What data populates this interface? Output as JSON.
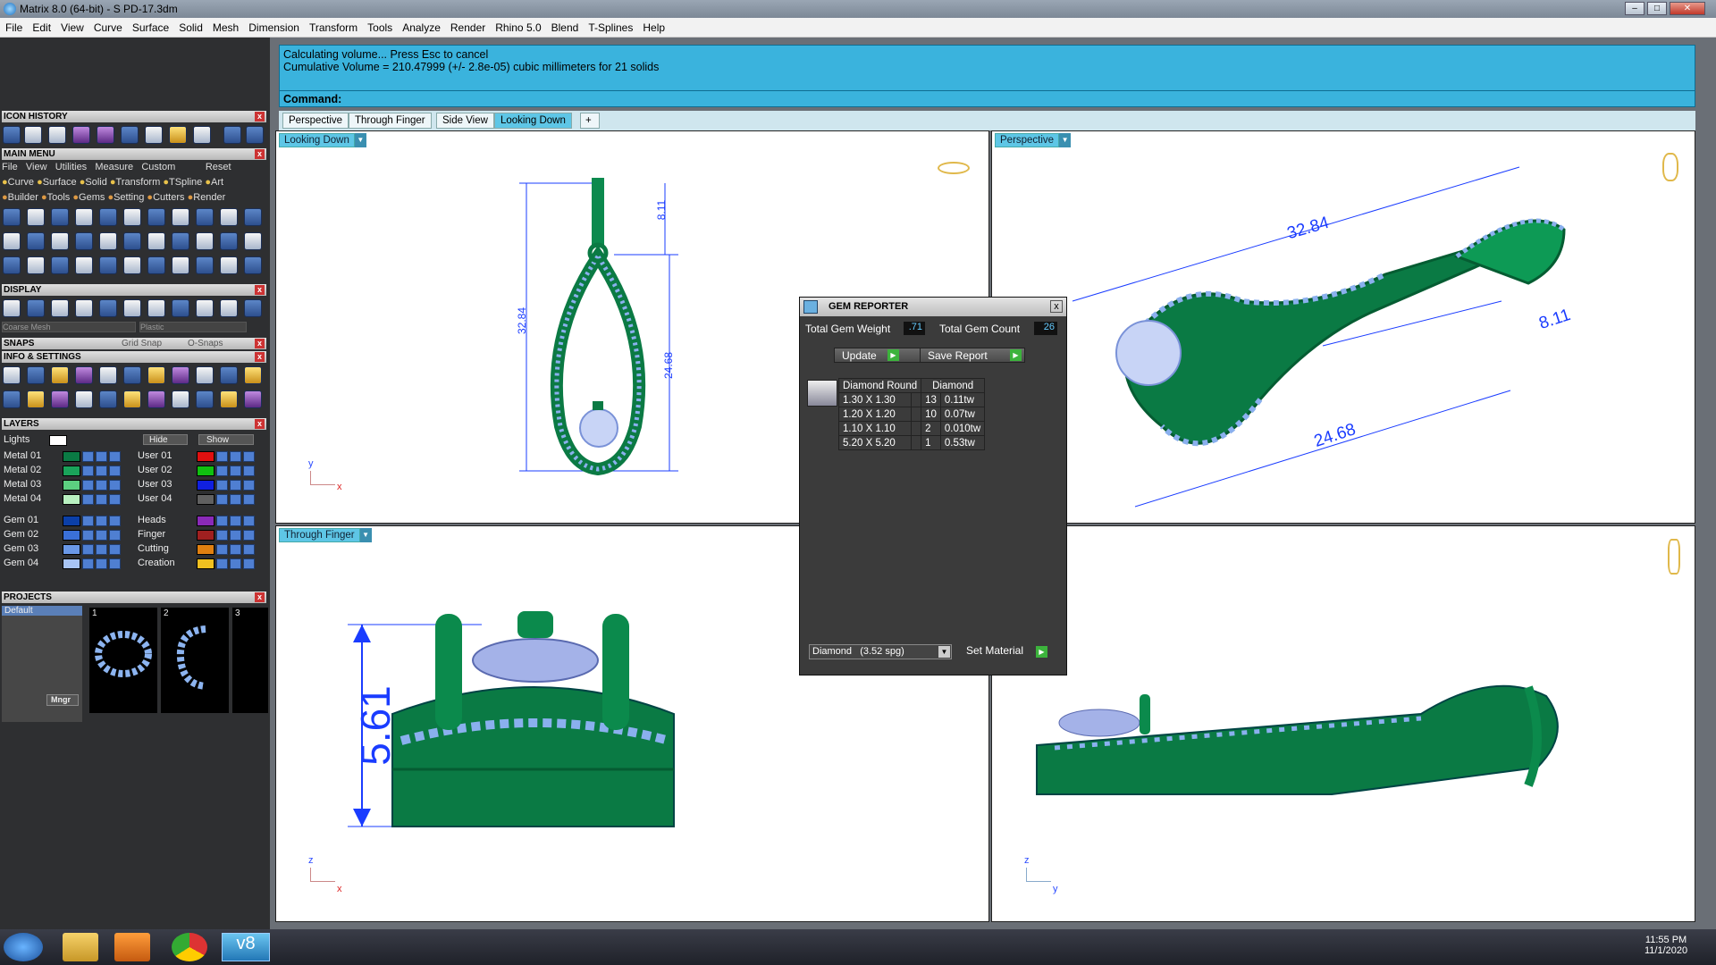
{
  "title": "Matrix 8.0 (64-bit) - S PD-17.3dm",
  "menu": [
    "File",
    "Edit",
    "View",
    "Curve",
    "Surface",
    "Solid",
    "Mesh",
    "Dimension",
    "Transform",
    "Tools",
    "Analyze",
    "Render",
    "Rhino 5.0",
    "Blend",
    "T-Splines",
    "Help"
  ],
  "cmd": {
    "line1": "Calculating volume... Press Esc to cancel",
    "line2": "Cumulative Volume = 210.47999 (+/- 2.8e-05) cubic millimeters for 21 solids",
    "prompt": "Command:"
  },
  "tabs": [
    "Perspective",
    "Through Finger",
    "Side View",
    "Looking Down"
  ],
  "panels": {
    "icon_history": "ICON HISTORY",
    "main_menu": "MAIN MENU",
    "main_menu_items": [
      "File",
      "View",
      "Utilities",
      "Measure",
      "Custom",
      "Reset"
    ],
    "main_menu_row1": [
      "Curve",
      "Surface",
      "Solid",
      "Transform",
      "TSpline",
      "Art"
    ],
    "main_menu_row2": [
      "Builder",
      "Tools",
      "Gems",
      "Setting",
      "Cutters",
      "Render"
    ],
    "display": "DISPLAY",
    "display_mesh": "Coarse Mesh",
    "display_material": "Plastic",
    "snaps": "SNAPS",
    "grid_snap": "Grid Snap",
    "osnaps": "O-Snaps",
    "info": "INFO & SETTINGS",
    "layers": "LAYERS",
    "lights": "Lights",
    "hide": "Hide",
    "show": "Show",
    "layers_left": [
      "Metal 01",
      "Metal 02",
      "Metal 03",
      "Metal 04",
      "Gem 01",
      "Gem 02",
      "Gem 03",
      "Gem 04"
    ],
    "layers_right": [
      "User 01",
      "User 02",
      "User 03",
      "User 04",
      "Heads",
      "Finger",
      "Cutting",
      "Creation"
    ],
    "projects": "PROJECTS",
    "project_default": "Default",
    "project_nums": [
      "1",
      "2",
      "3"
    ],
    "mngr": "Mngr"
  },
  "viewports": {
    "tl": {
      "label": "Looking Down",
      "dims": [
        "8.11",
        "32.84",
        "24.68"
      ],
      "axis": [
        "y",
        "x"
      ]
    },
    "tr": {
      "label": "Perspective",
      "dims": [
        "32.84",
        "8.11",
        "24.68"
      ]
    },
    "bl": {
      "label": "Through Finger",
      "dims": [
        "5.61"
      ],
      "axis": [
        "z",
        "x"
      ]
    },
    "br": {
      "axis": [
        "z",
        "y"
      ]
    }
  },
  "gem_reporter": {
    "title": "GEM REPORTER",
    "weight_label": "Total Gem Weight",
    "weight": ".71",
    "count_label": "Total Gem Count",
    "count": "26",
    "update": "Update",
    "save": "Save Report",
    "headers": [
      "Diamond Round",
      "Diamond"
    ],
    "rows": [
      [
        "1.30 X 1.30",
        "13",
        "0.11tw"
      ],
      [
        "1.20 X 1.20",
        "10",
        "0.07tw"
      ],
      [
        "1.10 X 1.10",
        "2",
        "0.010tw"
      ],
      [
        "5.20 X 5.20",
        "1",
        "0.53tw"
      ]
    ],
    "material": "Diamond",
    "spg": "(3.52 spg)",
    "set_material": "Set Material"
  },
  "clock": {
    "time": "11:55 PM",
    "date": "11/1/2020"
  }
}
